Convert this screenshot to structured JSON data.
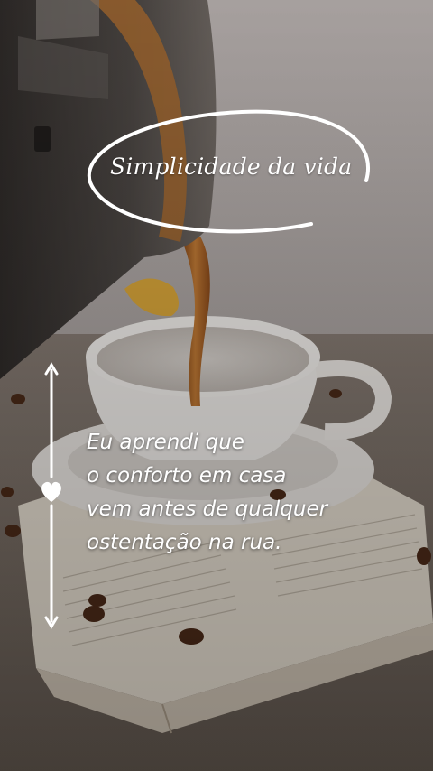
{
  "title": "Simplicidade da vida",
  "quote": {
    "lines": [
      "Eu aprendi que",
      "o conforto em casa",
      "vem antes de qualquer",
      "ostentação na rua."
    ]
  },
  "colors": {
    "text": "#ffffff",
    "wall": "#bdb6b3",
    "coffee": "#a9672a",
    "cup": "#f2efec",
    "book": "#e7dfd4"
  },
  "icons": [
    "heart-icon",
    "arrow-up-icon",
    "arrow-down-icon"
  ]
}
